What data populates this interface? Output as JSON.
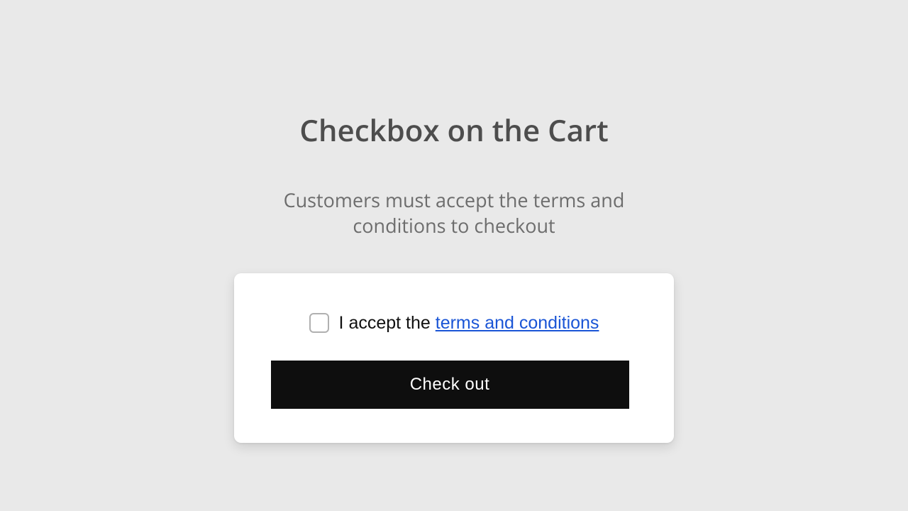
{
  "heading": "Checkbox on the Cart",
  "subheading": "Customers must accept the terms and conditions to checkout",
  "card": {
    "accept_prefix": "I accept the ",
    "accept_link": "terms and conditions",
    "checkout_label": "Check out"
  }
}
